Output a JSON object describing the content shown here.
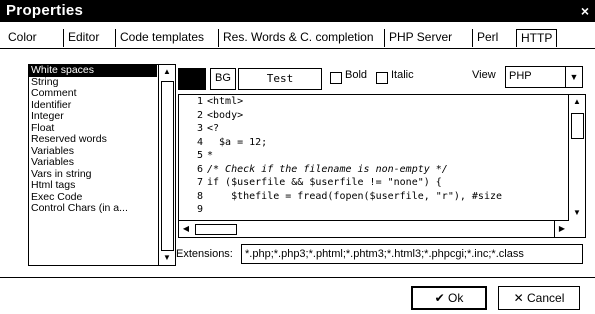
{
  "window": {
    "title": "Properties",
    "close_glyph": "×"
  },
  "tabs": [
    "Color",
    "Editor",
    "Code templates",
    "Res. Words & C. completion",
    "PHP Server",
    "Perl",
    "HTTP"
  ],
  "color_list": {
    "items": [
      "White spaces",
      "String",
      "Comment",
      "Identifier",
      "Integer",
      "Float",
      "Reserved words",
      "Variables",
      "Variables",
      "Vars in string",
      "Html tags",
      "Exec Code",
      "Control Chars (in a..."
    ],
    "selected_index": 0
  },
  "style": {
    "swatch_color": "#000000",
    "bg_label": "BG",
    "test_label": "Test",
    "bold_label": "Bold",
    "italic_label": "Italic",
    "bold_checked": false,
    "italic_checked": false,
    "view_label": "View",
    "view_value": "PHP"
  },
  "editor": {
    "line_numbers": [
      "1",
      "2",
      "3",
      "4",
      "5",
      "6",
      "7",
      "8",
      "9"
    ],
    "lines": [
      "<html>",
      "<body>",
      "<?",
      "  $a = 12;",
      "*",
      "/* Check if the filename is non-empty */",
      "if ($userfile && $userfile != \"none\") {",
      "    $thefile = fread(fopen($userfile, \"r\"), #size",
      ""
    ]
  },
  "extensions": {
    "label": "Extensions:",
    "value": "*.php;*.php3;*.phtml;*.phtm3;*.html3;*.phpcgi;*.inc;*.class"
  },
  "buttons": {
    "ok_label": "✔ Ok",
    "cancel_label": "✕ Cancel"
  },
  "icons": {
    "up": "▲",
    "down": "▼",
    "left": "◀",
    "right": "▶"
  }
}
